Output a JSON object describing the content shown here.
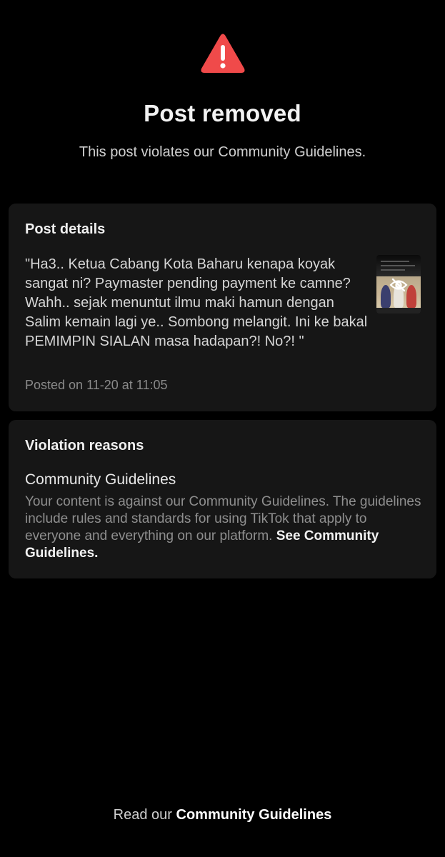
{
  "header": {
    "icon": "warning-triangle-icon",
    "icon_color": "#f04a4a",
    "title": "Post removed",
    "subtitle": "This post violates our Community Guidelines."
  },
  "post_details": {
    "heading": "Post details",
    "text": "\"Ha3.. Ketua Cabang Kota Baharu kenapa koyak sangat ni? Paymaster pending payment ke camne? Wahh.. sejak menuntut ilmu maki hamun dengan Salim kemain lagi ye.. Sombong melangit. Ini ke bakal PEMIMPIN SIALAN masa hadapan?! No?! \"",
    "posted_on": "Posted on 11-20 at 11:05",
    "thumbnail_icon": "eye-slash-icon"
  },
  "violation": {
    "heading": "Violation reasons",
    "title": "Community Guidelines",
    "description": "Your content is against our Community Guidelines. The guidelines include rules and standards for using TikTok that apply to everyone and everything on our platform. ",
    "link": "See Community Guidelines."
  },
  "footer": {
    "prefix": "Read our ",
    "link": "Community Guidelines"
  }
}
